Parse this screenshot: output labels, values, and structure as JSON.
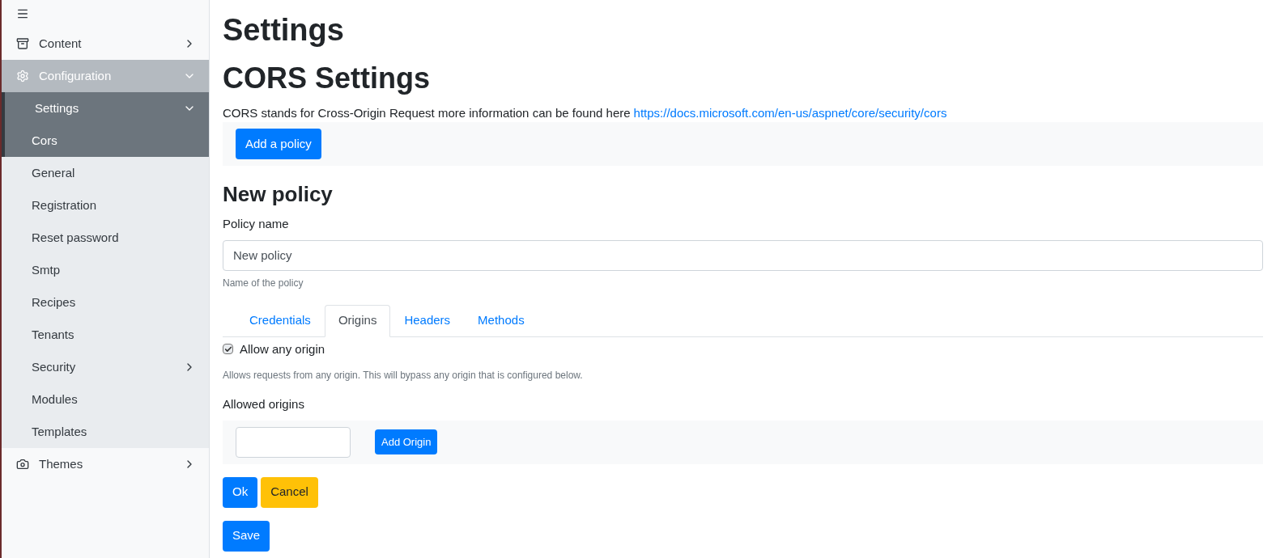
{
  "sidebar": {
    "items": [
      {
        "label": "Content",
        "expanded": false
      },
      {
        "label": "Configuration",
        "expanded": true,
        "children": [
          {
            "label": "Settings",
            "expanded": true,
            "children": [
              {
                "label": "Cors"
              }
            ]
          },
          {
            "label": "General"
          },
          {
            "label": "Registration"
          },
          {
            "label": "Reset password"
          },
          {
            "label": "Smtp"
          },
          {
            "label": "Recipes"
          },
          {
            "label": "Tenants"
          },
          {
            "label": "Security",
            "expanded": false
          },
          {
            "label": "Modules"
          },
          {
            "label": "Templates"
          }
        ]
      },
      {
        "label": "Themes",
        "expanded": false
      }
    ]
  },
  "page": {
    "title": "Settings",
    "subtitle": "CORS Settings",
    "description": "CORS stands for Cross-Origin Request more information can be found here",
    "link": "https://docs.microsoft.com/en-us/aspnet/core/security/cors",
    "add_policy_button": "Add a policy"
  },
  "policy": {
    "heading": "New policy",
    "name_label": "Policy name",
    "name_value": "New policy",
    "name_help": "Name of the policy",
    "tabs": [
      {
        "label": "Credentials",
        "selected": false
      },
      {
        "label": "Origins",
        "selected": true
      },
      {
        "label": "Headers",
        "selected": false
      },
      {
        "label": "Methods",
        "selected": false
      }
    ],
    "allow_any": {
      "label": "Allow any origin",
      "checked": true
    },
    "allow_any_help": "Allows requests from any origin. This will bypass any origin that is configured below.",
    "origins_label": "Allowed origins",
    "add_origin_button": "Add Origin",
    "ok_button": "Ok",
    "cancel_button": "Cancel"
  },
  "save_button": "Save"
}
